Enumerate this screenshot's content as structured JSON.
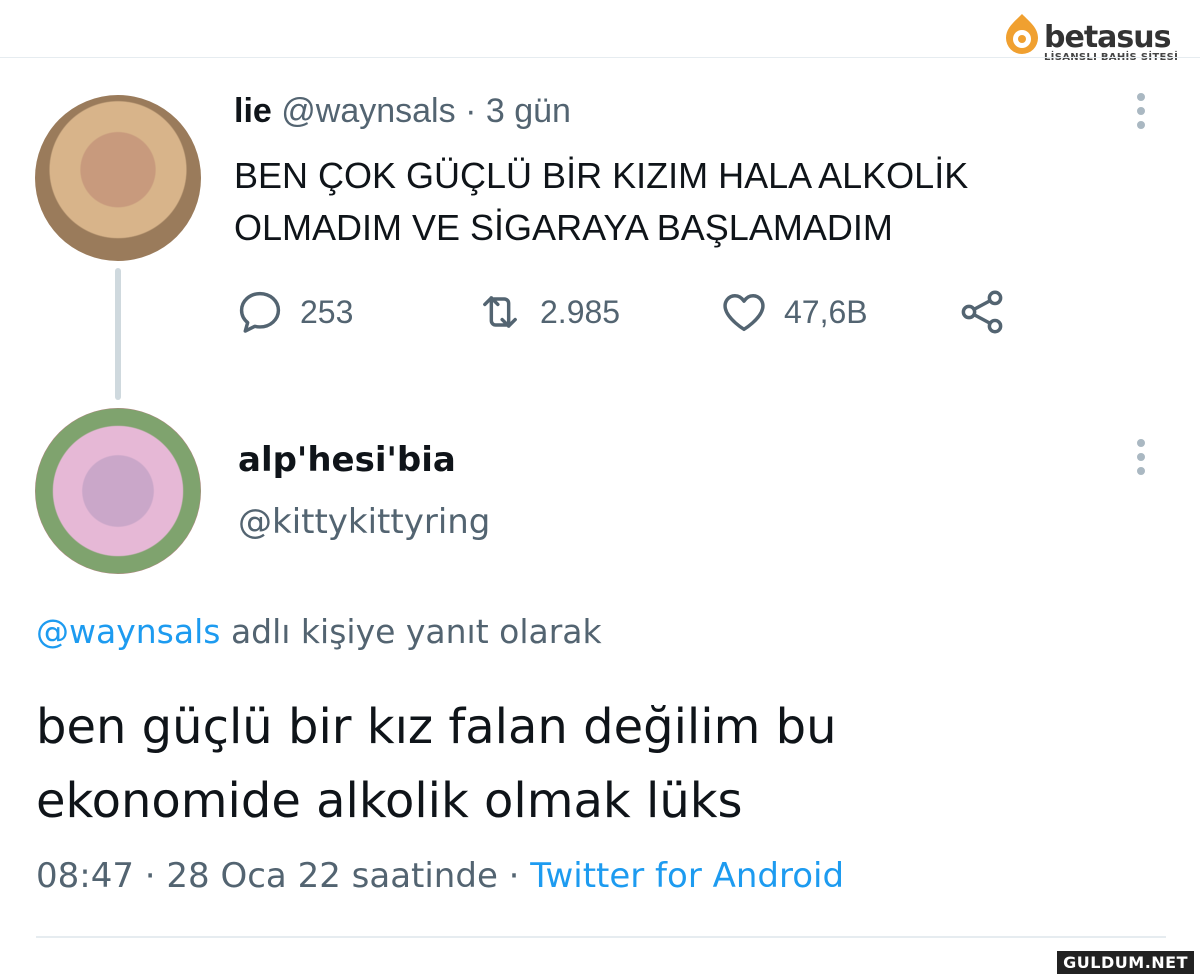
{
  "watermark": {
    "brand": "betasus",
    "tagline": "LİSANSLI BAHİS SİTESİ",
    "footer": "GULDUM.NET"
  },
  "tweet1": {
    "name": "lie",
    "handle": "@waynsals",
    "separator": "·",
    "time": "3 gün",
    "text_line1": "BEN ÇOK GÜÇLÜ BİR KIZIM HALA ALKOLİK",
    "text_line2": "OLMADIM VE SİGARAYA BAŞLAMADIM",
    "actions": {
      "reply_count": "253",
      "retweet_count": "2.985",
      "like_count": "47,6B"
    }
  },
  "tweet2": {
    "name": "alp'hesi'bia",
    "handle": "@kittykittyring",
    "reply_mention": "@waynsals",
    "reply_suffix": "adlı kişiye yanıt olarak",
    "text_line1": "ben güçlü bir kız falan değilim bu",
    "text_line2": "ekonomide alkolik olmak lüks",
    "timestamp": "08:47 · 28 Oca 22 saatinde ·",
    "source": "Twitter for Android"
  },
  "colors": {
    "accent": "#1d9bf0",
    "secondary_text": "#536471",
    "primary_text": "#0f1419",
    "icon": "#536471"
  },
  "icons": [
    "reply-icon",
    "retweet-icon",
    "like-icon",
    "share-icon",
    "more-icon"
  ]
}
